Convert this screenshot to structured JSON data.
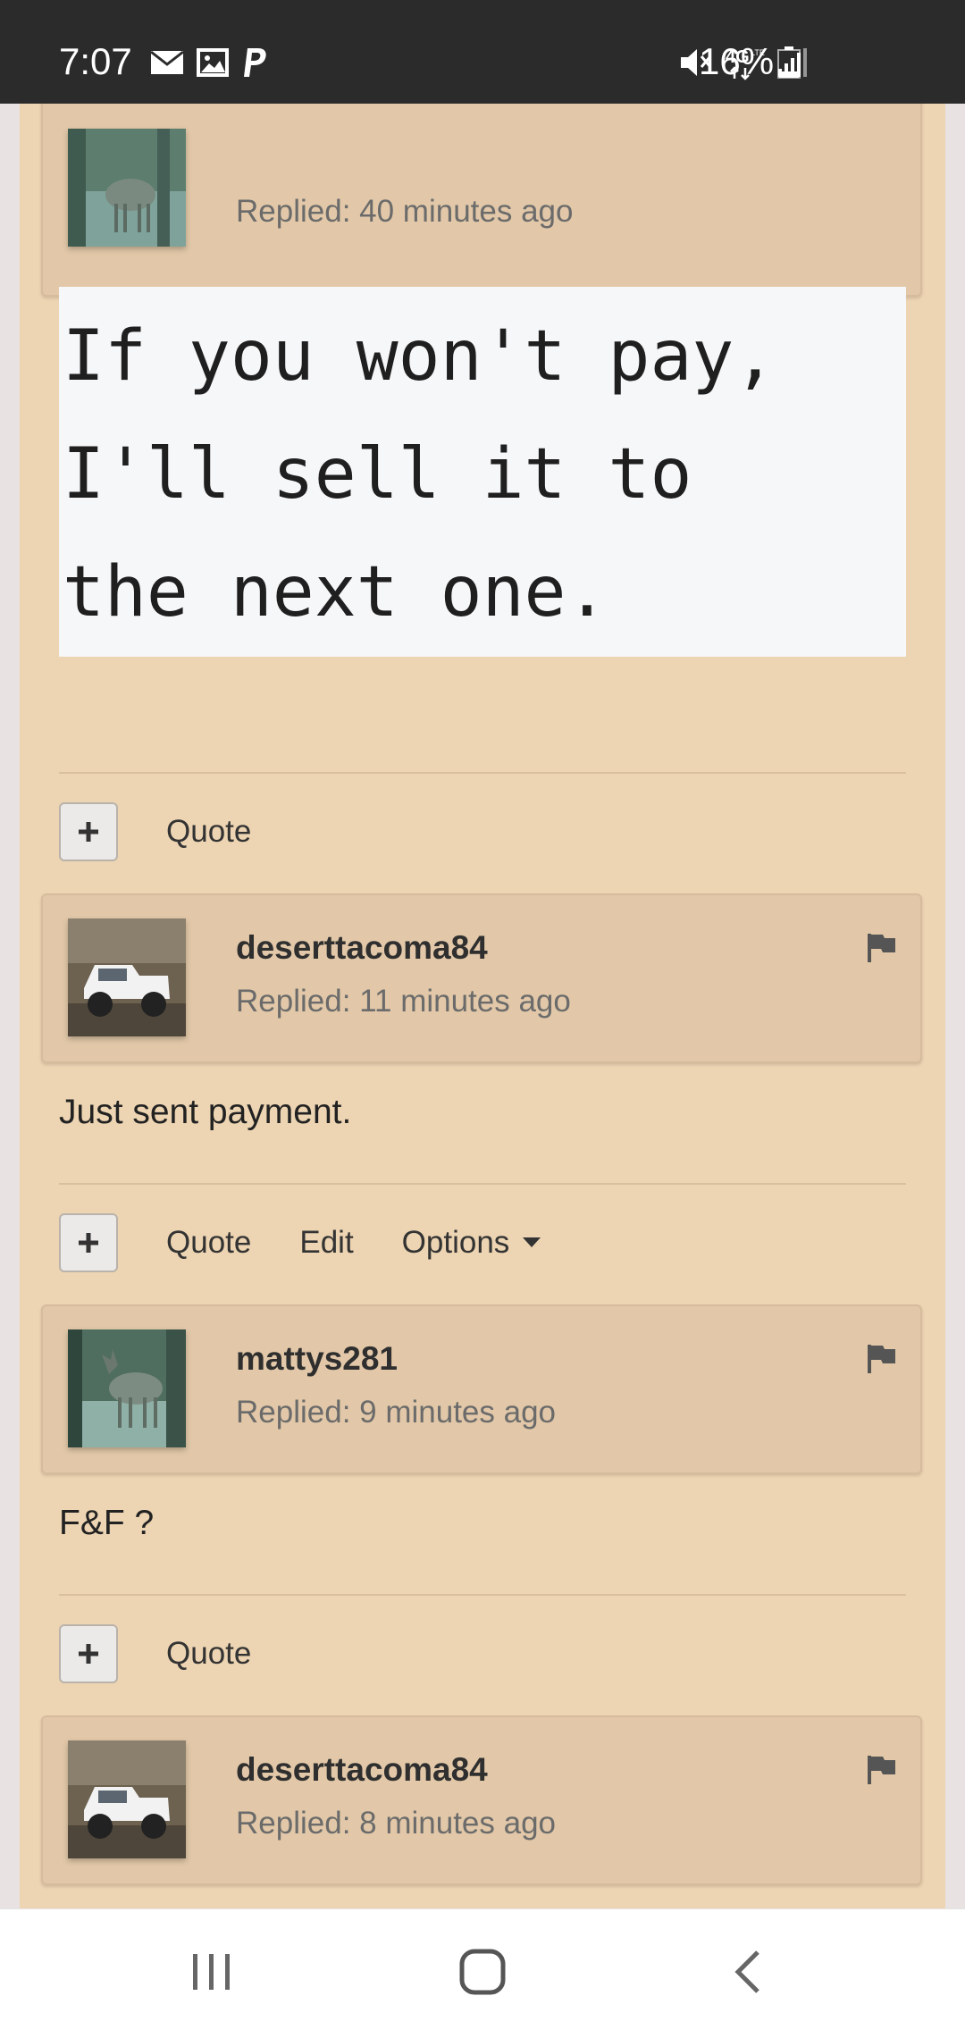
{
  "status_bar": {
    "time": "7:07",
    "left_icons": [
      "mail-icon",
      "image-icon",
      "paypal-icon"
    ],
    "right_icons": [
      "mute-icon",
      "4g-lte-icon",
      "signal-icon"
    ],
    "battery_text": "16%"
  },
  "posts": [
    {
      "replied_text": "Replied: 40 minutes ago",
      "avatar": "deer-avatar"
    },
    {
      "body_code": "If you won't pay,\nI'll sell it to\nthe next one.",
      "actions": [
        "Quote"
      ]
    },
    {
      "username": "deserttacoma84",
      "replied_text": "Replied: 11 minutes ago",
      "avatar": "truck-avatar",
      "body": "Just sent payment.",
      "actions": [
        "Quote",
        "Edit",
        "Options"
      ]
    },
    {
      "username": "mattys281",
      "replied_text": "Replied: 9 minutes ago",
      "avatar": "deer-avatar",
      "body": "F&F ?",
      "actions": [
        "Quote"
      ]
    },
    {
      "username": "deserttacoma84",
      "replied_text": "Replied: 8 minutes ago",
      "avatar": "truck-avatar"
    }
  ],
  "colors": {
    "page_bg": "#edd4b2",
    "card_bg": "#e2c8a8",
    "status_bar": "#2b2b2b"
  }
}
